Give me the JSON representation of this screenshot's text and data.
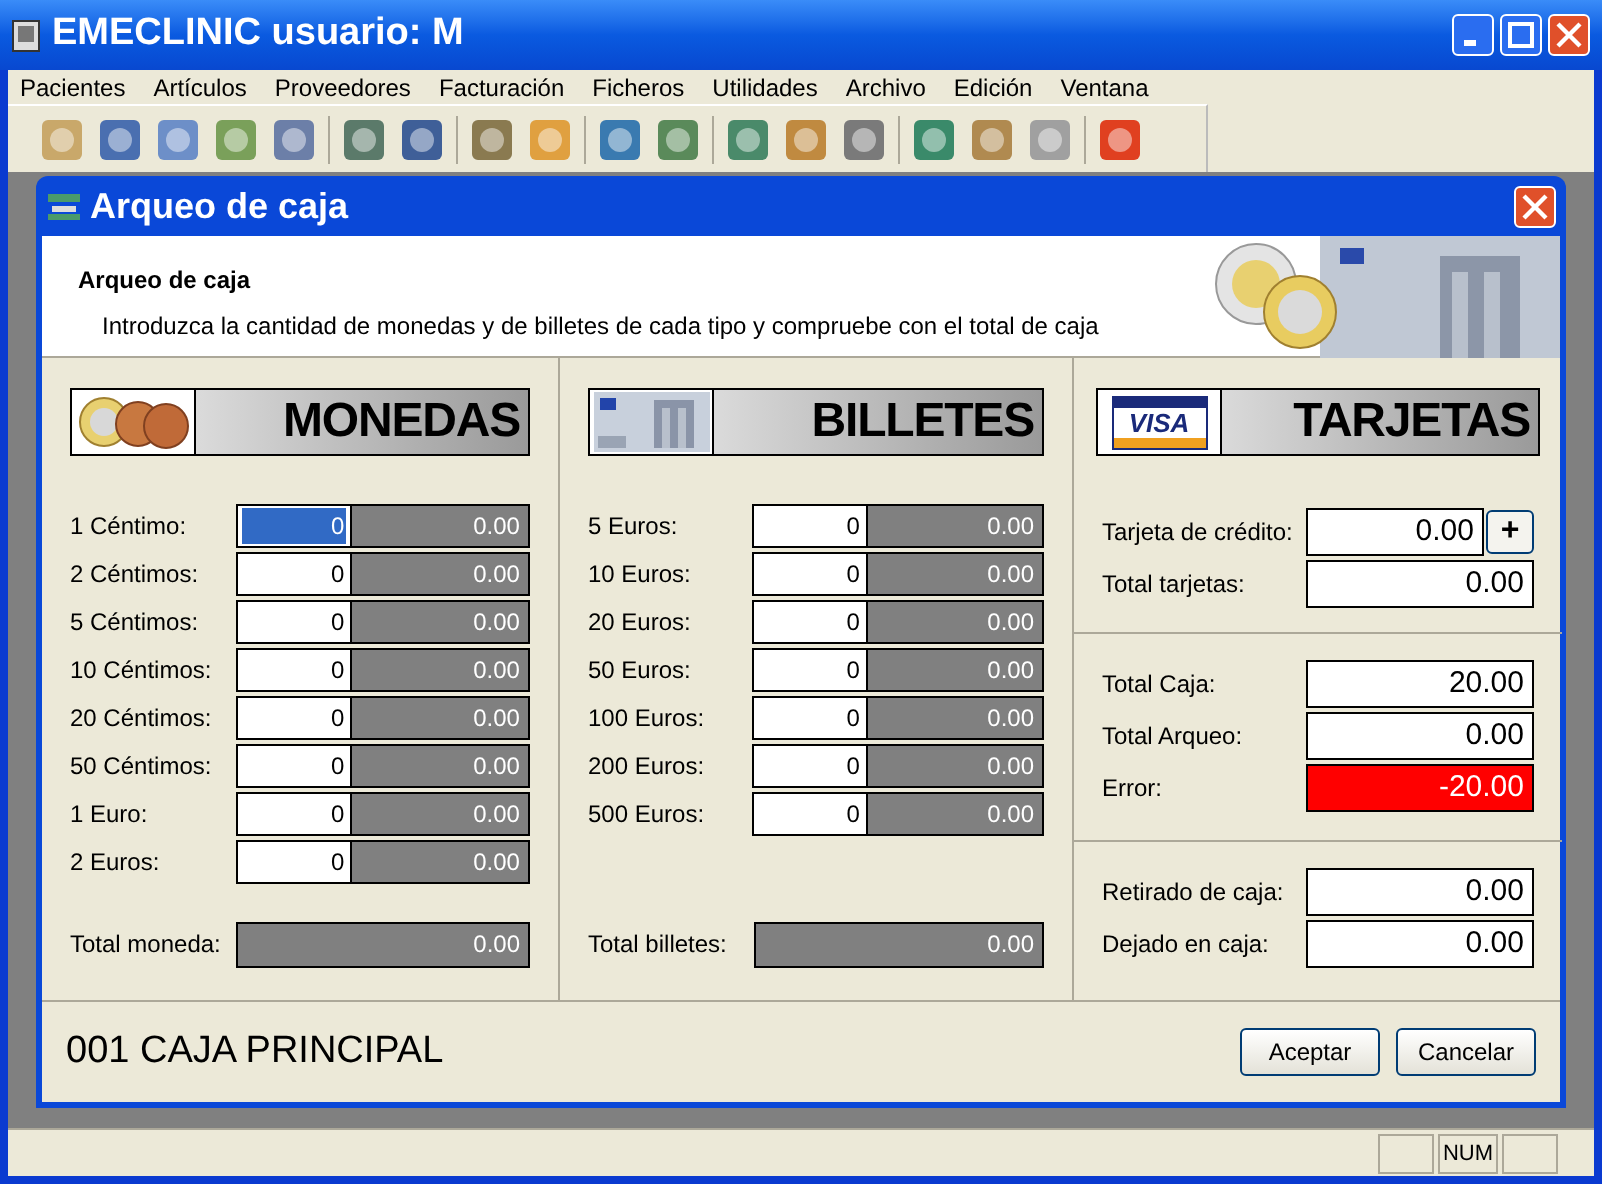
{
  "window": {
    "title": "EMECLINIC usuario: M"
  },
  "menu": [
    "Pacientes",
    "Artículos",
    "Proveedores",
    "Facturación",
    "Ficheros",
    "Utilidades",
    "Archivo",
    "Edición",
    "Ventana"
  ],
  "dialog": {
    "title": "Arqueo de caja",
    "header_title": "Arqueo de caja",
    "header_text": "Introduzca la cantidad de monedas y de billetes de cada tipo y compruebe con el total de caja"
  },
  "monedas": {
    "banner": "MONEDAS",
    "rows": [
      {
        "label": "1 Céntimo:",
        "count": "0",
        "amount": "0.00",
        "focused": true
      },
      {
        "label": "2 Céntimos:",
        "count": "0",
        "amount": "0.00",
        "focused": false
      },
      {
        "label": "5 Céntimos:",
        "count": "0",
        "amount": "0.00",
        "focused": false
      },
      {
        "label": "10 Céntimos:",
        "count": "0",
        "amount": "0.00",
        "focused": false
      },
      {
        "label": "20 Céntimos:",
        "count": "0",
        "amount": "0.00",
        "focused": false
      },
      {
        "label": "50 Céntimos:",
        "count": "0",
        "amount": "0.00",
        "focused": false
      },
      {
        "label": "1 Euro:",
        "count": "0",
        "amount": "0.00",
        "focused": false
      },
      {
        "label": "2 Euros:",
        "count": "0",
        "amount": "0.00",
        "focused": false
      }
    ],
    "total_label": "Total moneda:",
    "total": "0.00"
  },
  "billetes": {
    "banner": "BILLETES",
    "rows": [
      {
        "label": "5 Euros:",
        "count": "0",
        "amount": "0.00",
        "focused": false
      },
      {
        "label": "10 Euros:",
        "count": "0",
        "amount": "0.00",
        "focused": false
      },
      {
        "label": "20 Euros:",
        "count": "0",
        "amount": "0.00",
        "focused": false
      },
      {
        "label": "50 Euros:",
        "count": "0",
        "amount": "0.00",
        "focused": false
      },
      {
        "label": "100 Euros:",
        "count": "0",
        "amount": "0.00",
        "focused": false
      },
      {
        "label": "200 Euros:",
        "count": "0",
        "amount": "0.00",
        "focused": false
      },
      {
        "label": "500 Euros:",
        "count": "0",
        "amount": "0.00",
        "focused": false
      }
    ],
    "total_label": "Total billetes:",
    "total": "0.00"
  },
  "tarjetas": {
    "banner": "TARJETAS",
    "visa": "VISA",
    "add_button": "+",
    "sections": [
      [
        {
          "label": "Tarjeta de crédito:",
          "value": "0.00",
          "kind": "add"
        },
        {
          "label": "Total tarjetas:",
          "value": "0.00",
          "kind": "value"
        }
      ],
      [
        {
          "label": "Total Caja:",
          "value": "20.00",
          "kind": "value"
        },
        {
          "label": "Total Arqueo:",
          "value": "0.00",
          "kind": "value"
        },
        {
          "label": "Error:",
          "value": "-20.00",
          "kind": "error"
        }
      ],
      [
        {
          "label": "Retirado de caja:",
          "value": "0.00",
          "kind": "value"
        },
        {
          "label": "Dejado en caja:",
          "value": "0.00",
          "kind": "value"
        }
      ]
    ]
  },
  "footer": {
    "caja": "001 CAJA PRINCIPAL",
    "buttons": [
      "Aceptar",
      "Cancelar"
    ]
  },
  "status_bar": {
    "num": "NUM"
  }
}
